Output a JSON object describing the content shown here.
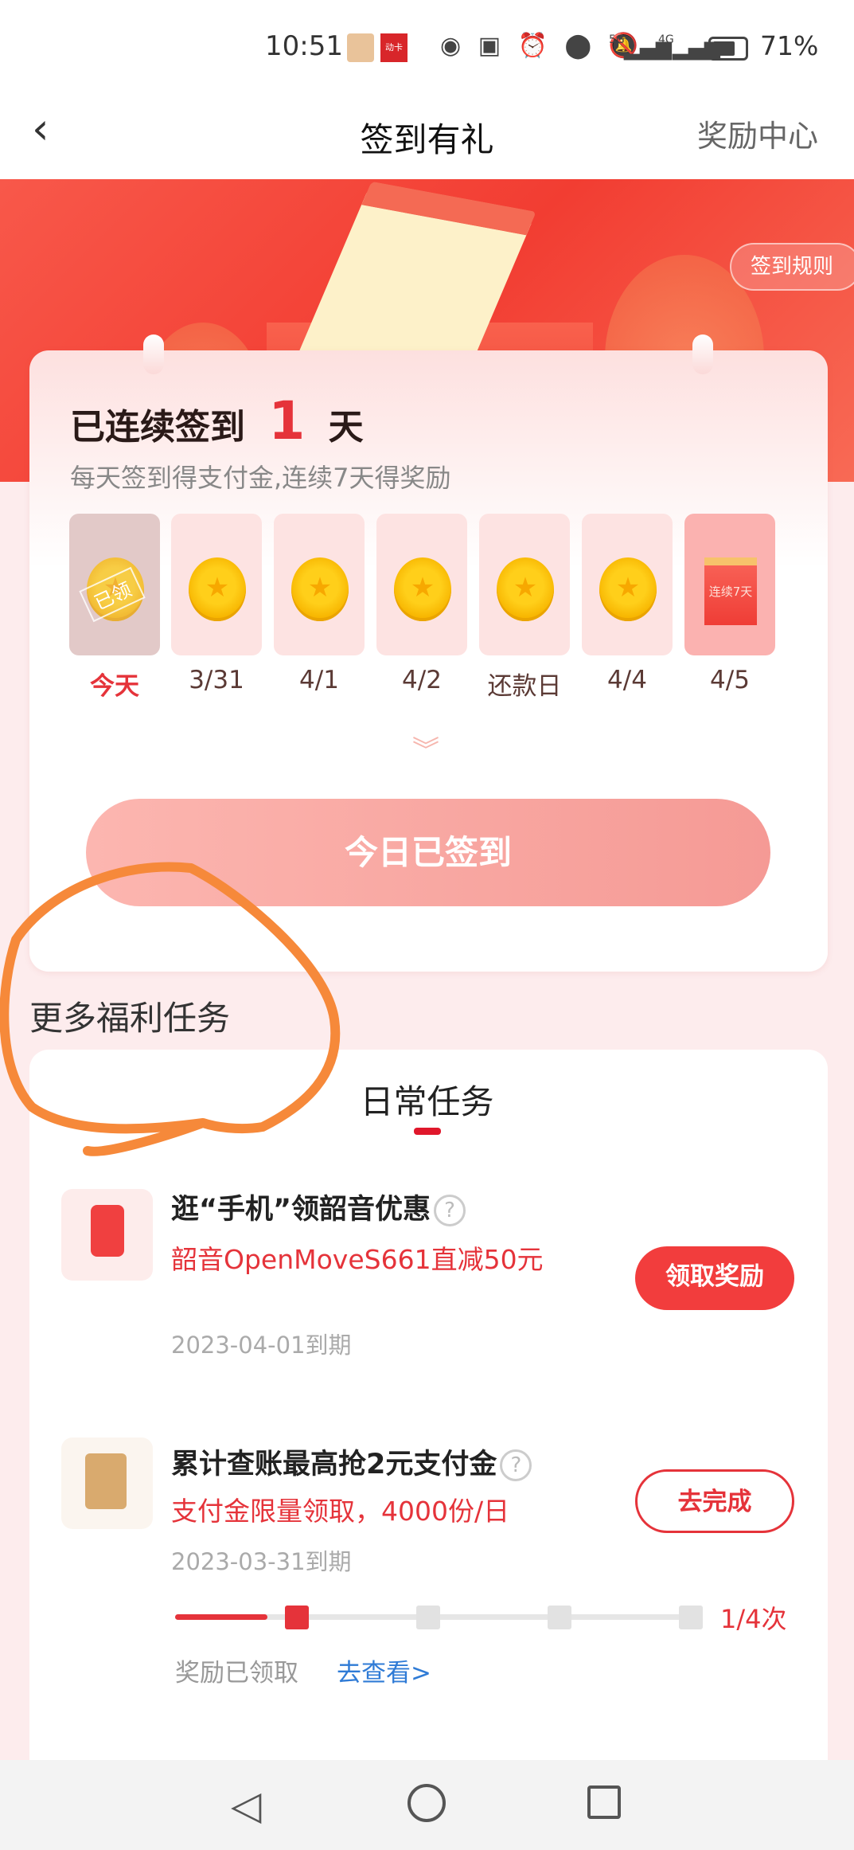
{
  "status_bar": {
    "time": "10:51",
    "app_badge": "动卡",
    "battery": "71%",
    "network": [
      "5G",
      "4G"
    ],
    "icons": [
      "eye-icon",
      "nfc-icon",
      "alarm-icon",
      "location-icon",
      "mute-icon",
      "signal-icon",
      "battery-icon"
    ]
  },
  "nav": {
    "title": "签到有礼",
    "right_link": "奖励中心",
    "back_icon": "chevron-left-icon"
  },
  "banner": {
    "rules_button": "签到规则"
  },
  "checkin": {
    "prefix": "已连续签到",
    "count": "1",
    "suffix": "天",
    "subtitle": "每天签到得支付金,连续7天得奖励",
    "days": [
      {
        "label": "今天",
        "state": "claimed",
        "stamp": "已领"
      },
      {
        "label": "3/31"
      },
      {
        "label": "4/1"
      },
      {
        "label": "4/2"
      },
      {
        "label": "还款日"
      },
      {
        "label": "4/4"
      },
      {
        "label": "4/5",
        "gift": "连续7天"
      }
    ],
    "button": "今日已签到"
  },
  "section_title": "更多福利任务",
  "tasks": {
    "tab": "日常任务",
    "items": [
      {
        "title": "逛“手机”领韶音优惠",
        "desc": "韶音OpenMoveS661直减50元",
        "date": "2023-04-01到期",
        "button": "领取奖励"
      },
      {
        "title": "累计查账最高抢2元支付金",
        "desc": "支付金限量领取，4000份/日",
        "date": "2023-03-31到期",
        "button": "去完成",
        "progress": {
          "current": 1,
          "total": 4,
          "label": "1/4次"
        },
        "claimed": "奖励已领取",
        "view_link": "去查看>"
      }
    ]
  },
  "colors": {
    "accent": "#f03c3c",
    "annotation": "#f6893a",
    "link": "#2f7bd6"
  }
}
